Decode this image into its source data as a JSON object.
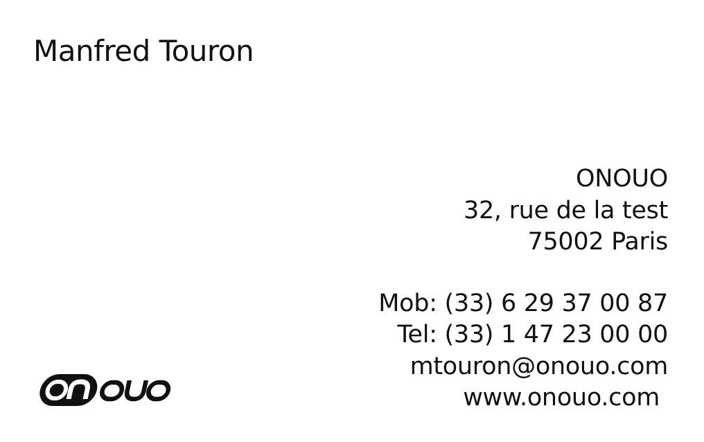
{
  "card": {
    "name": "Manfred Touron",
    "company": "ONOUO",
    "address_line1": "32, rue de la test",
    "address_line2": "75002 Paris",
    "mobile": "Mob: (33) 6 29 37 00 87",
    "telephone": "Tel: (33) 1 47 23 00 00",
    "email": "mtouron@onouo.com",
    "website": "www.onouo.com"
  },
  "logo": {
    "text": "onouo",
    "icon": "onouo-logo-icon",
    "color": "#111111"
  }
}
